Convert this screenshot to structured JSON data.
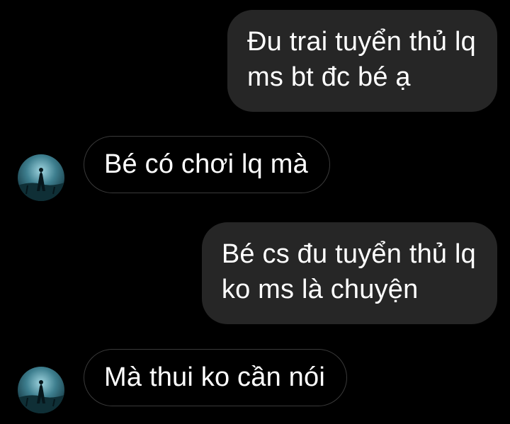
{
  "messages": [
    {
      "side": "sent",
      "lines": [
        "Đu trai tuyển thủ lq",
        "ms bt đc bé ạ"
      ]
    },
    {
      "side": "received",
      "lines": [
        "Bé có chơi lq mà"
      ]
    },
    {
      "side": "sent",
      "lines": [
        "Bé cs đu tuyển thủ lq",
        "ko ms là chuyện"
      ]
    },
    {
      "side": "received",
      "lines": [
        "Mà thui ko cần nói"
      ]
    }
  ],
  "avatar": {
    "icon": "contact-avatar-icon"
  },
  "colors": {
    "background": "#000000",
    "sent_bubble": "#262626",
    "received_border": "#3a3a3a",
    "text": "#ffffff"
  }
}
